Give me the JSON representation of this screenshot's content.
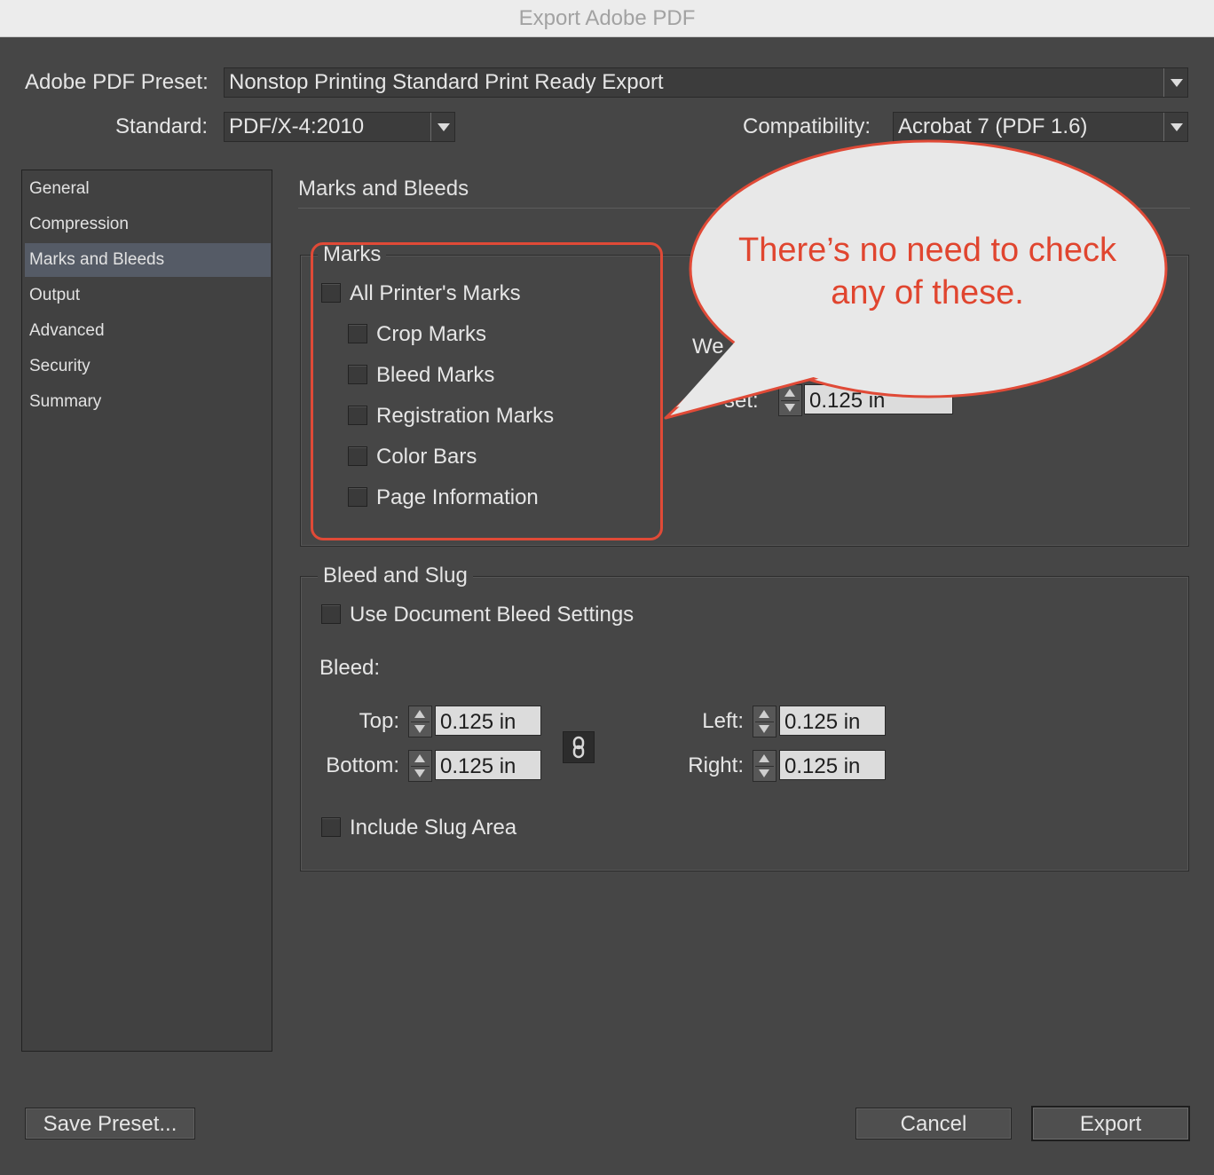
{
  "window": {
    "title": "Export Adobe PDF"
  },
  "preset": {
    "label": "Adobe PDF Preset:",
    "value": "Nonstop Printing Standard Print Ready Export"
  },
  "standard": {
    "label": "Standard:",
    "value": "PDF/X-4:2010"
  },
  "compatibility": {
    "label": "Compatibility:",
    "value": "Acrobat 7 (PDF 1.6)"
  },
  "sidebar": {
    "items": [
      {
        "label": "General"
      },
      {
        "label": "Compression"
      },
      {
        "label": "Marks and Bleeds"
      },
      {
        "label": "Output"
      },
      {
        "label": "Advanced"
      },
      {
        "label": "Security"
      },
      {
        "label": "Summary"
      }
    ],
    "active": "Marks and Bleeds"
  },
  "main": {
    "title": "Marks and Bleeds",
    "marks": {
      "legend": "Marks",
      "all_printers_marks": "All Printer's Marks",
      "items": [
        {
          "label": "Crop Marks",
          "checked": false
        },
        {
          "label": "Bleed Marks",
          "checked": false
        },
        {
          "label": "Registration Marks",
          "checked": false
        },
        {
          "label": "Color Bars",
          "checked": false
        },
        {
          "label": "Page Information",
          "checked": false
        }
      ],
      "weight_label_partial": "We",
      "offset_label_partial": "set:",
      "offset_value": "0.125 in"
    },
    "bleed_slug": {
      "legend": "Bleed and Slug",
      "use_doc_bleed": "Use Document Bleed Settings",
      "bleed_label": "Bleed:",
      "top": {
        "label": "Top:",
        "value": "0.125 in"
      },
      "bottom": {
        "label": "Bottom:",
        "value": "0.125 in"
      },
      "left": {
        "label": "Left:",
        "value": "0.125 in"
      },
      "right": {
        "label": "Right:",
        "value": "0.125 in"
      },
      "include_slug": "Include Slug Area"
    }
  },
  "callout": {
    "line1": "There’s no need to check",
    "line2": "any of these."
  },
  "footer": {
    "save_preset": "Save Preset...",
    "cancel": "Cancel",
    "export": "Export"
  },
  "colors": {
    "annotation_red": "#e04a37",
    "dialog_bg": "#464646",
    "callout_fill": "#e8e8e8"
  }
}
